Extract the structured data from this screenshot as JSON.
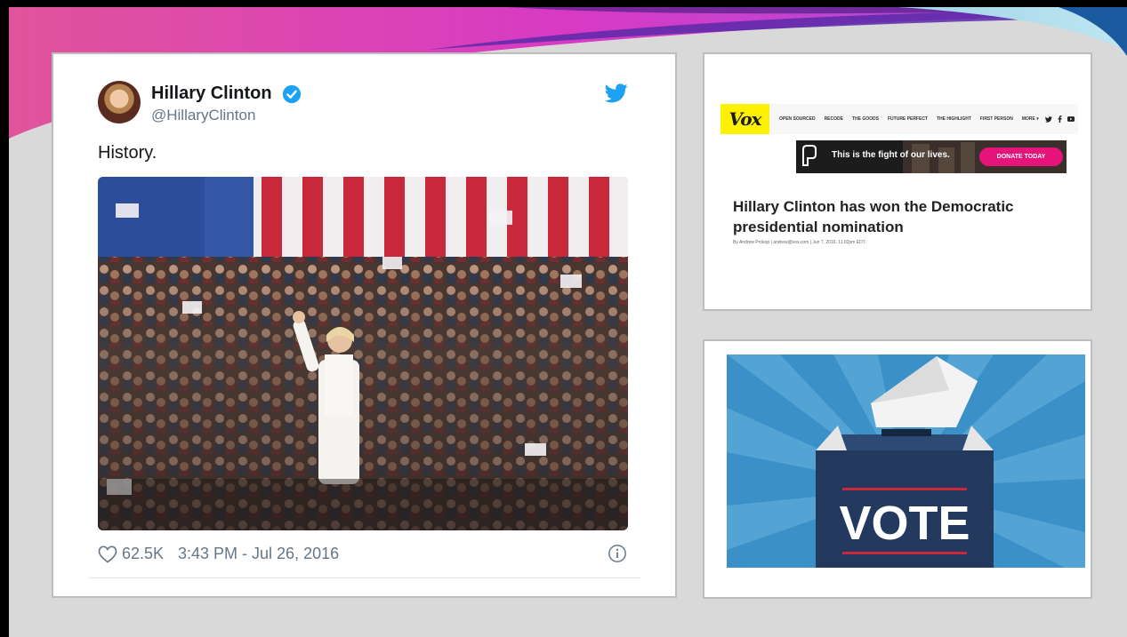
{
  "tweet": {
    "author_name": "Hillary Clinton",
    "author_handle": "@HillaryClinton",
    "text": "History.",
    "likes": "62.5K",
    "timestamp": "3:43 PM - Jul 26, 2016"
  },
  "vox": {
    "logo": "Vox",
    "nav_items": [
      "OPEN SOURCED",
      "RECODE",
      "THE GOODS",
      "FUTURE PERFECT",
      "THE HIGHLIGHT",
      "FIRST PERSON",
      "MORE ▾"
    ],
    "social_icons": [
      "twitter-icon",
      "facebook-icon",
      "youtube-icon"
    ],
    "ad_text": "This is the fight of our lives.",
    "ad_button": "DONATE TODAY",
    "headline": "Hillary Clinton has won the Democratic presidential nomination",
    "byline": "By Andrew Prokop | andrew@vox.com | Jun 7, 2016, 11:02pm EDT"
  },
  "vote": {
    "label": "VOTE"
  },
  "colors": {
    "twitter_blue": "#1da1f2",
    "vox_yellow": "#fff200",
    "ad_pink": "#e4147a",
    "vote_box_navy": "#233a5e",
    "vote_background": "#3b90c8"
  }
}
